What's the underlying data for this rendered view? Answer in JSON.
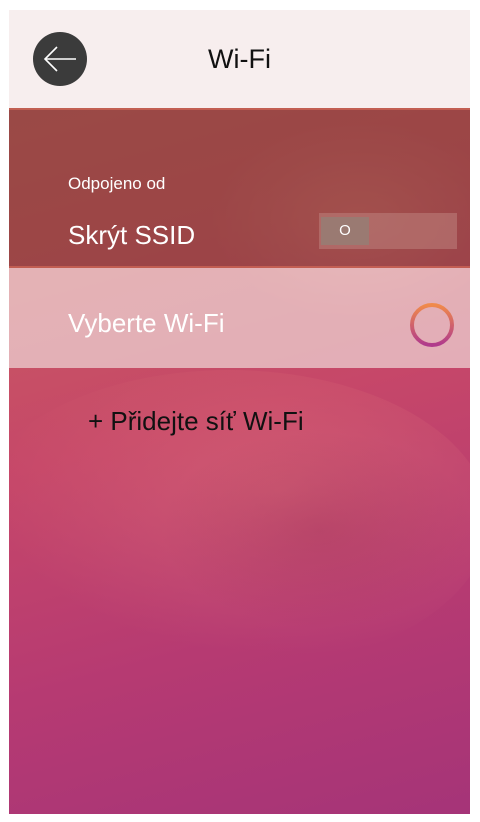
{
  "header": {
    "title": "Wi-Fi",
    "back_icon": "arrow-left-icon"
  },
  "ssid_section": {
    "status_label": "Odpojeno od",
    "hide_ssid_label": "Skrýt SSID",
    "toggle_value": "O"
  },
  "select_row": {
    "label": "Vyberte Wi-Fi",
    "spinner_icon": "loading-spinner-icon"
  },
  "add_network": {
    "label": "+ Přidejte síť Wi-Fi"
  },
  "colors": {
    "header_bg": "#f7eeee",
    "back_button_bg": "#3b3b3b",
    "spinner_start": "#f08a4b",
    "spinner_end": "#b03a8c"
  }
}
